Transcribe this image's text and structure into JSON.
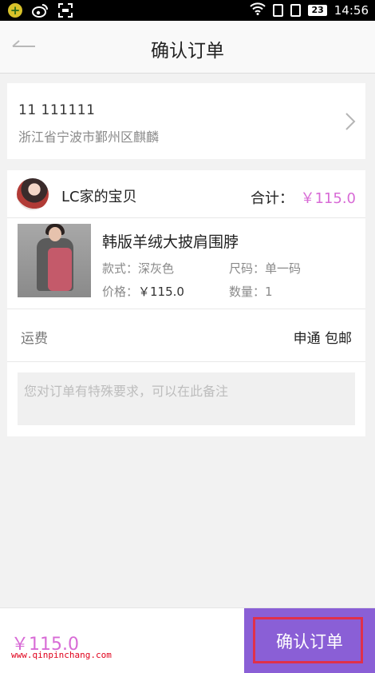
{
  "status_bar": {
    "battery": "23",
    "time": "14:56"
  },
  "header": {
    "title": "确认订单",
    "back_icon": "back-arrow-icon"
  },
  "address": {
    "name_phone": "11   111111",
    "address": "浙江省宁波市鄞州区麒麟",
    "chevron_icon": "chevron-right-icon"
  },
  "order": {
    "shop_name": "LC家的宝贝",
    "total_label": "合计：",
    "total_value": "￥115.0",
    "item": {
      "title": "韩版羊绒大披肩围脖",
      "style_label": "款式：",
      "style_value": "深灰色",
      "size_label": "尺码：",
      "size_value": "单一码",
      "price_label": "价格：",
      "price_value": "￥115.0",
      "qty_label": "数量：",
      "qty_value": "1"
    },
    "shipping_label": "运费",
    "shipping_value": "申通  包邮",
    "note_placeholder": "您对订单有特殊要求，可以在此备注"
  },
  "bottom": {
    "price": "￥115.0",
    "watermark": "www.qinpinchang.com",
    "confirm_label": "确认订单"
  },
  "colors": {
    "accent": "#d86bd6",
    "button": "#8a5fd6",
    "highlight": "#e0304a"
  }
}
